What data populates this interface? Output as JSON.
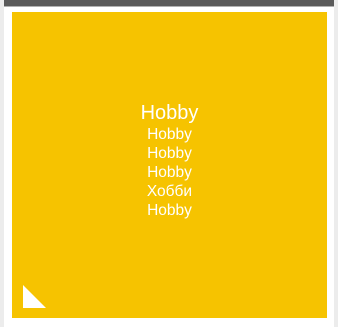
{
  "tile": {
    "label": "Hobby",
    "translations": [
      "Hobby",
      "Hobby",
      "Hobby",
      "Хобби",
      "Hobby"
    ],
    "background_color": "#f6c300",
    "text_color": "#ffffff",
    "corner_icon": "corner-triangle-icon"
  }
}
